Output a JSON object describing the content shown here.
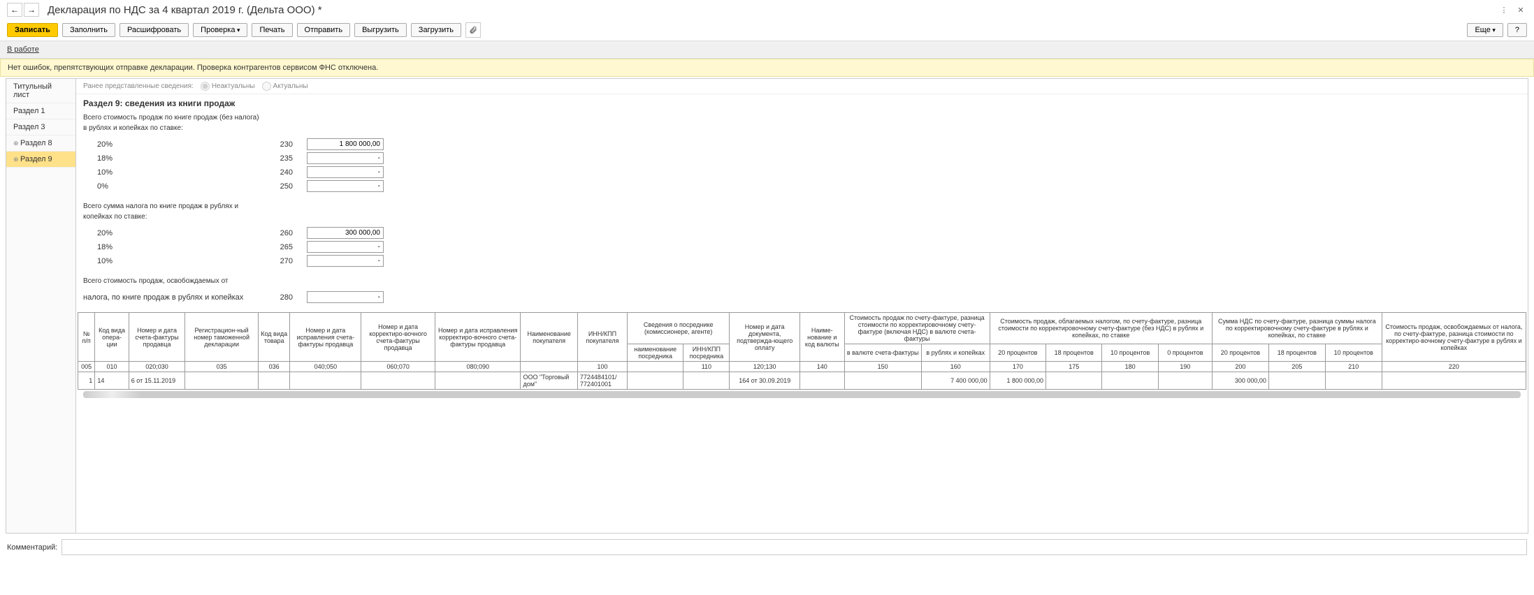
{
  "header": {
    "title": "Декларация по НДС за 4 квартал 2019 г. (Дельта ООО) *"
  },
  "toolbar": {
    "record": "Записать",
    "fill": "Заполнить",
    "decode": "Расшифровать",
    "check": "Проверка",
    "print": "Печать",
    "send": "Отправить",
    "upload": "Выгрузить",
    "load": "Загрузить",
    "more": "Еще",
    "help": "?"
  },
  "status": {
    "text": "В работе"
  },
  "info": {
    "text": "Нет ошибок, препятствующих отправке декларации. Проверка контрагентов сервисом ФНС отключена."
  },
  "sidebar": {
    "items": [
      {
        "label": "Титульный лист"
      },
      {
        "label": "Раздел 1"
      },
      {
        "label": "Раздел 3"
      },
      {
        "label": "Раздел 8"
      },
      {
        "label": "Раздел 9"
      }
    ]
  },
  "prior": {
    "label": "Ранее представленные сведения:",
    "opt1": "Неактуальны",
    "opt2": "Актуальны"
  },
  "section": {
    "title": "Раздел 9: сведения из книги продаж",
    "desc1": "Всего стоимость продаж по книге продаж (без налога)",
    "desc1b": "в рублях и копейках по ставке:",
    "desc2": "Всего сумма налога по книге продаж в рублях и",
    "desc2b": "копейках по ставке:",
    "desc3": "Всего стоимость продаж, освобождаемых от",
    "desc3b": "налога, по книге продаж в рублях и копейках",
    "rates_sales": [
      {
        "label": "20%",
        "code": "230",
        "val": "1 800 000,00"
      },
      {
        "label": "18%",
        "code": "235",
        "val": "-"
      },
      {
        "label": "10%",
        "code": "240",
        "val": "-"
      },
      {
        "label": "0%",
        "code": "250",
        "val": "-"
      }
    ],
    "rates_tax": [
      {
        "label": "20%",
        "code": "260",
        "val": "300 000,00"
      },
      {
        "label": "18%",
        "code": "265",
        "val": "-"
      },
      {
        "label": "10%",
        "code": "270",
        "val": "-"
      }
    ],
    "rate_exempt": {
      "code": "280",
      "val": "-"
    }
  },
  "tbl": {
    "h": {
      "c1": "№ п/п",
      "c2": "Код вида опера-ции",
      "c3": "Номер и дата счета-фактуры продавца",
      "c4": "Регистрацион-ный номер таможенной декларации",
      "c5": "Код вида товара",
      "c6": "Номер и дата исправления счета-фактуры продавца",
      "c7": "Номер и дата корректиро-вочного счета-фактуры продавца",
      "c8": "Номер и дата исправления корректиро-вочного счета-фактуры продавца",
      "c9": "Наименование покупателя",
      "c10": "ИНН/КПП покупателя",
      "c11": "Сведения о посреднике (комиссионере, агенте)",
      "c11a": "наименование посредника",
      "c11b": "ИНН/КПП посредника",
      "c12": "Номер и дата документа, подтвержда-ющего оплату",
      "c13": "Наиме-нование и код валюты",
      "c14": "Стоимость продаж по счету-фактуре, разница стоимости по корректировочному счету-фактуре (включая НДС) в валюте счета-фактуры",
      "c14a": "в валюте счета-фактуры",
      "c14b": "в рублях и копейках",
      "c15": "Стоимость продаж, облагаемых налогом, по счету-фактуре, разница стоимости по корректировочному счету-фактуре (без НДС) в рублях и копейках, по ставке",
      "c15a": "20 процентов",
      "c15b": "18 процентов",
      "c15c": "10 процентов",
      "c15d": "0 процентов",
      "c16": "Сумма НДС по счету-фактуре, разница суммы налога по корректировочному счету-фактуре в рублях и копейках, по ставке",
      "c16a": "20 процентов",
      "c16b": "18 процентов",
      "c16c": "10 процентов",
      "c17": "Стоимость продаж, освобождаемых от налога, по счету-фактуре, разница стоимости по корректиро-вочному счету-фактуре в рублях и копейках"
    },
    "codes": {
      "c1": "005",
      "c2": "010",
      "c3": "020;030",
      "c4": "035",
      "c5": "036",
      "c6": "040;050",
      "c7": "060;070",
      "c8": "080;090",
      "c10": "100",
      "c11b": "110",
      "c12": "120;130",
      "c13": "140",
      "c14a": "150",
      "c14b": "160",
      "c15a": "170",
      "c15b": "175",
      "c15c": "180",
      "c15d": "190",
      "c16a": "200",
      "c16b": "205",
      "c16c": "210",
      "c17": "220"
    },
    "row": {
      "n": "1",
      "op": "14",
      "sf": "6 от 15.11.2019",
      "buyer": "ООО \"Торговый дом\"",
      "inn": "7724484101/ 772401001",
      "doc": "164 от 30.09.2019",
      "sum_rub": "7 400 000,00",
      "s20": "1 800 000,00",
      "n20": "300 000,00"
    }
  },
  "footer": {
    "label": "Комментарий:"
  }
}
